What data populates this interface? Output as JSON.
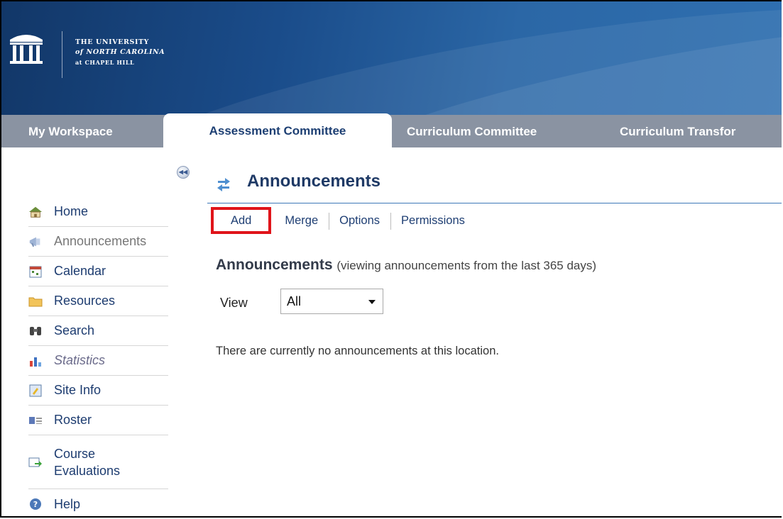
{
  "header": {
    "logo_line1": "THE UNIVERSITY",
    "logo_line2": "of NORTH CAROLINA",
    "logo_line3": "at CHAPEL HILL"
  },
  "tabs": [
    {
      "label": "My Workspace",
      "active": false
    },
    {
      "label": "Assessment Committee",
      "active": true
    },
    {
      "label": "Curriculum Committee",
      "active": false
    },
    {
      "label": "Curriculum Transfor",
      "active": false
    }
  ],
  "sidebar": {
    "collapse_icon": "double-chevron-left-icon",
    "items": [
      {
        "label": "Home",
        "icon": "home-icon"
      },
      {
        "label": "Announcements",
        "icon": "megaphone-icon",
        "current": true
      },
      {
        "label": "Calendar",
        "icon": "calendar-icon"
      },
      {
        "label": "Resources",
        "icon": "folder-icon"
      },
      {
        "label": "Search",
        "icon": "binoculars-icon"
      },
      {
        "label": "Statistics",
        "icon": "bar-chart-icon"
      },
      {
        "label": "Site Info",
        "icon": "site-info-icon"
      },
      {
        "label": "Roster",
        "icon": "roster-icon"
      },
      {
        "label": "Course",
        "label2": "Evaluations",
        "icon": "evaluation-icon"
      },
      {
        "label": "Help",
        "icon": "help-icon"
      }
    ]
  },
  "main": {
    "tool_icon": "reset-arrows-icon",
    "title": "Announcements",
    "actions": [
      {
        "label": "Add"
      },
      {
        "label": "Merge"
      },
      {
        "label": "Options"
      },
      {
        "label": "Permissions"
      }
    ],
    "list_heading": "Announcements",
    "list_subheading": "(viewing announcements from the last 365 days)",
    "view_label": "View",
    "view_selected": "All",
    "empty_message": "There are currently no announcements at this location."
  },
  "colors": {
    "header_blue": "#1a4c8a",
    "tab_bar": "#8a93a2",
    "link_blue": "#1e3e73",
    "highlight_red": "#e0141a"
  }
}
